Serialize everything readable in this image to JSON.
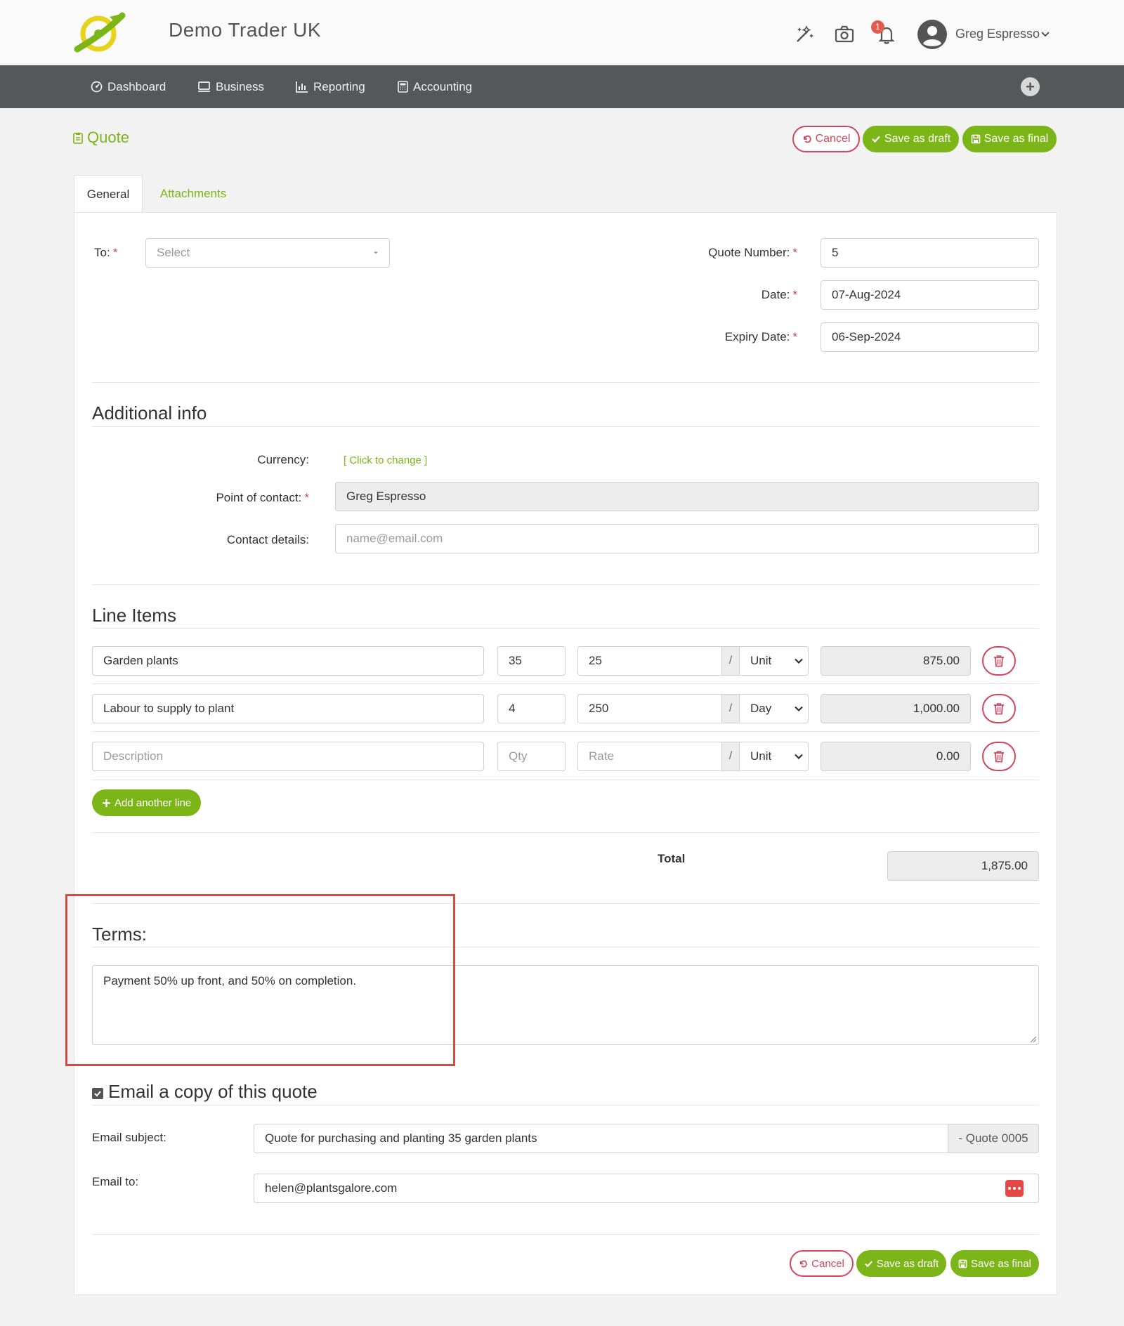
{
  "header": {
    "company": "Demo Trader UK",
    "notification_count": "1",
    "user_name": "Greg Espresso",
    "icons": [
      "magic-wand-icon",
      "camera-icon",
      "bell-icon",
      "user-avatar-icon",
      "chevron-down-icon"
    ]
  },
  "nav": {
    "items": [
      {
        "label": "Dashboard",
        "icon": "dashboard-icon"
      },
      {
        "label": "Business",
        "icon": "business-icon"
      },
      {
        "label": "Reporting",
        "icon": "chart-icon"
      },
      {
        "label": "Accounting",
        "icon": "calculator-icon"
      }
    ],
    "plus": "+"
  },
  "page": {
    "title": "Quote",
    "actions": {
      "cancel": "Cancel",
      "save_draft": "Save as draft",
      "save_final": "Save as final"
    }
  },
  "tabs": [
    {
      "label": "General"
    },
    {
      "label": "Attachments"
    }
  ],
  "form": {
    "to_label": "To:",
    "to_placeholder": "Select",
    "quote_number_label": "Quote Number:",
    "quote_number": "5",
    "date_label": "Date:",
    "date": "07-Aug-2024",
    "expiry_label": "Expiry Date:",
    "expiry": "06-Sep-2024"
  },
  "additional": {
    "heading": "Additional info",
    "currency_label": "Currency:",
    "currency_link": "[ Click to change ]",
    "contact_label": "Point of contact:",
    "contact_value": "Greg Espresso",
    "details_label": "Contact details:",
    "details_placeholder": "name@email.com"
  },
  "line_items": {
    "heading": "Line Items",
    "rows": [
      {
        "description": "Garden plants",
        "qty": "35",
        "rate": "25",
        "unit": "Unit",
        "amount": "875.00"
      },
      {
        "description": "Labour to supply to plant",
        "qty": "4",
        "rate": "250",
        "unit": "Day",
        "amount": "1,000.00"
      },
      {
        "description": "Description",
        "qty": "Qty",
        "rate": "Rate",
        "unit": "Unit",
        "amount": "0.00"
      }
    ],
    "slash": "/",
    "add_line": "Add another line",
    "total_label": "Total",
    "total": "1,875.00"
  },
  "terms": {
    "heading": "Terms:",
    "text": "Payment 50% up front, and 50% on completion."
  },
  "email": {
    "heading": "Email a copy of this quote",
    "subject_label": "Email subject:",
    "subject": "Quote for purchasing and planting 35 garden plants",
    "subject_suffix": "- Quote 0005",
    "to_label": "Email to:",
    "to": "helen@plantsgalore.com"
  },
  "colors": {
    "brand_green": "#7cb518",
    "danger": "#d2465c",
    "nav_bg": "#56575a",
    "highlight": "#d54a42"
  }
}
